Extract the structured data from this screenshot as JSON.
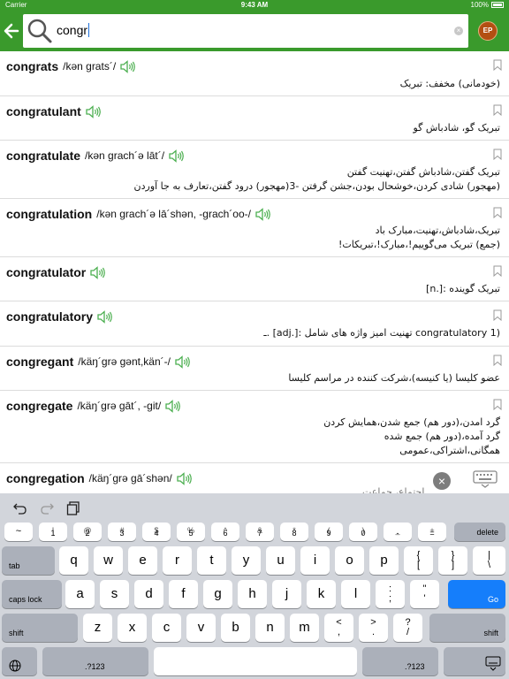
{
  "status": {
    "carrier": "Carrier",
    "time": "9:43 AM",
    "battery": "100%"
  },
  "search": {
    "value": "congr",
    "clear_label": "×"
  },
  "profile": {
    "badge": "EP"
  },
  "entries": [
    {
      "headword": "congrats",
      "pron": "/kən grats´/",
      "defs": [
        "(خودمانی) مخفف: تبریک"
      ]
    },
    {
      "headword": "congratulant",
      "pron": "",
      "defs": [
        "تبریک گو، شادباش گو"
      ]
    },
    {
      "headword": "congratulate",
      "pron": "/kən grach´ə lāt´/",
      "defs": [
        "تبریک گفتن،شادباش گفتن،تهنیت گفتن",
        "(مهجور) شادی کردن،خوشحال بودن،جشن گرفتن -3(مهجور) درود گفتن،تعارف به جا آوردن"
      ]
    },
    {
      "headword": "congratulation",
      "pron": "/kən grach´ə lā´shən, -grach´oo-/",
      "defs": [
        "تبریک،شادباش،تهنیت،مبارک باد",
        "(جمع) تبریک می‌گوییم!،مبارک!،تبریکات!"
      ]
    },
    {
      "headword": "congratulator",
      "pron": "",
      "defs": [
        "تبریک گوینده :[.n]"
      ]
    },
    {
      "headword": "congratulatory",
      "pron": "",
      "defs": [
        "(1 congratulatory تهنیت امیز واژه های شامل :[.adj] .ـ"
      ]
    },
    {
      "headword": "congregant",
      "pron": "/käŋ´grə gənt,kän´-/",
      "defs": [
        "عضو کلیسا (یا کنیسه)،شرکت کننده در مراسم کلیسا"
      ]
    },
    {
      "headword": "congregate",
      "pron": "/käŋ´grə gāt´, -git/",
      "defs": [
        "گرد امدن،(دور هم) جمع شدن،همایش کردن",
        "گرد آمده،(دور هم) جمع شده",
        "همگانی،اشتراکی،عمومی"
      ]
    },
    {
      "headword": "congregation",
      "pron": "/käŋ´grə gā´shən/",
      "defs": []
    }
  ],
  "hidden_hint": "اجتماع، جماعت",
  "keyboard": {
    "close_label": "×",
    "row1": [
      {
        "top": "~",
        "bottom": "`"
      },
      {
        "top": "!",
        "bottom": "1"
      },
      {
        "top": "@",
        "bottom": "2"
      },
      {
        "top": "#",
        "bottom": "3"
      },
      {
        "top": "$",
        "bottom": "4"
      },
      {
        "top": "%",
        "bottom": "5"
      },
      {
        "top": "^",
        "bottom": "6"
      },
      {
        "top": "&",
        "bottom": "7"
      },
      {
        "top": "*",
        "bottom": "8"
      },
      {
        "top": "(",
        "bottom": "9"
      },
      {
        "top": ")",
        "bottom": "0"
      },
      {
        "top": "_",
        "bottom": "-"
      },
      {
        "top": "+",
        "bottom": "="
      }
    ],
    "delete": "delete",
    "tab": "tab",
    "row2": [
      "q",
      "w",
      "e",
      "r",
      "t",
      "y",
      "u",
      "i",
      "o",
      "p"
    ],
    "row2_extra": [
      {
        "top": "{",
        "bottom": "["
      },
      {
        "top": "}",
        "bottom": "]"
      },
      {
        "top": "|",
        "bottom": "\\"
      }
    ],
    "caps": "caps lock",
    "row3": [
      "a",
      "s",
      "d",
      "f",
      "g",
      "h",
      "j",
      "k",
      "l"
    ],
    "row3_extra": [
      {
        "top": ":",
        "bottom": ";"
      },
      {
        "top": "\"",
        "bottom": "'"
      }
    ],
    "go": "Go",
    "shift": "shift",
    "row4": [
      "z",
      "x",
      "c",
      "v",
      "b",
      "n",
      "m"
    ],
    "row4_extra": [
      {
        "top": "<",
        "bottom": ","
      },
      {
        "top": ">",
        "bottom": "."
      },
      {
        "top": "?",
        "bottom": "/"
      }
    ],
    "numbers": ".?123"
  },
  "colors": {
    "primary": "#3a9a2c",
    "speaker": "#4caf50",
    "go_key": "#157efb"
  }
}
